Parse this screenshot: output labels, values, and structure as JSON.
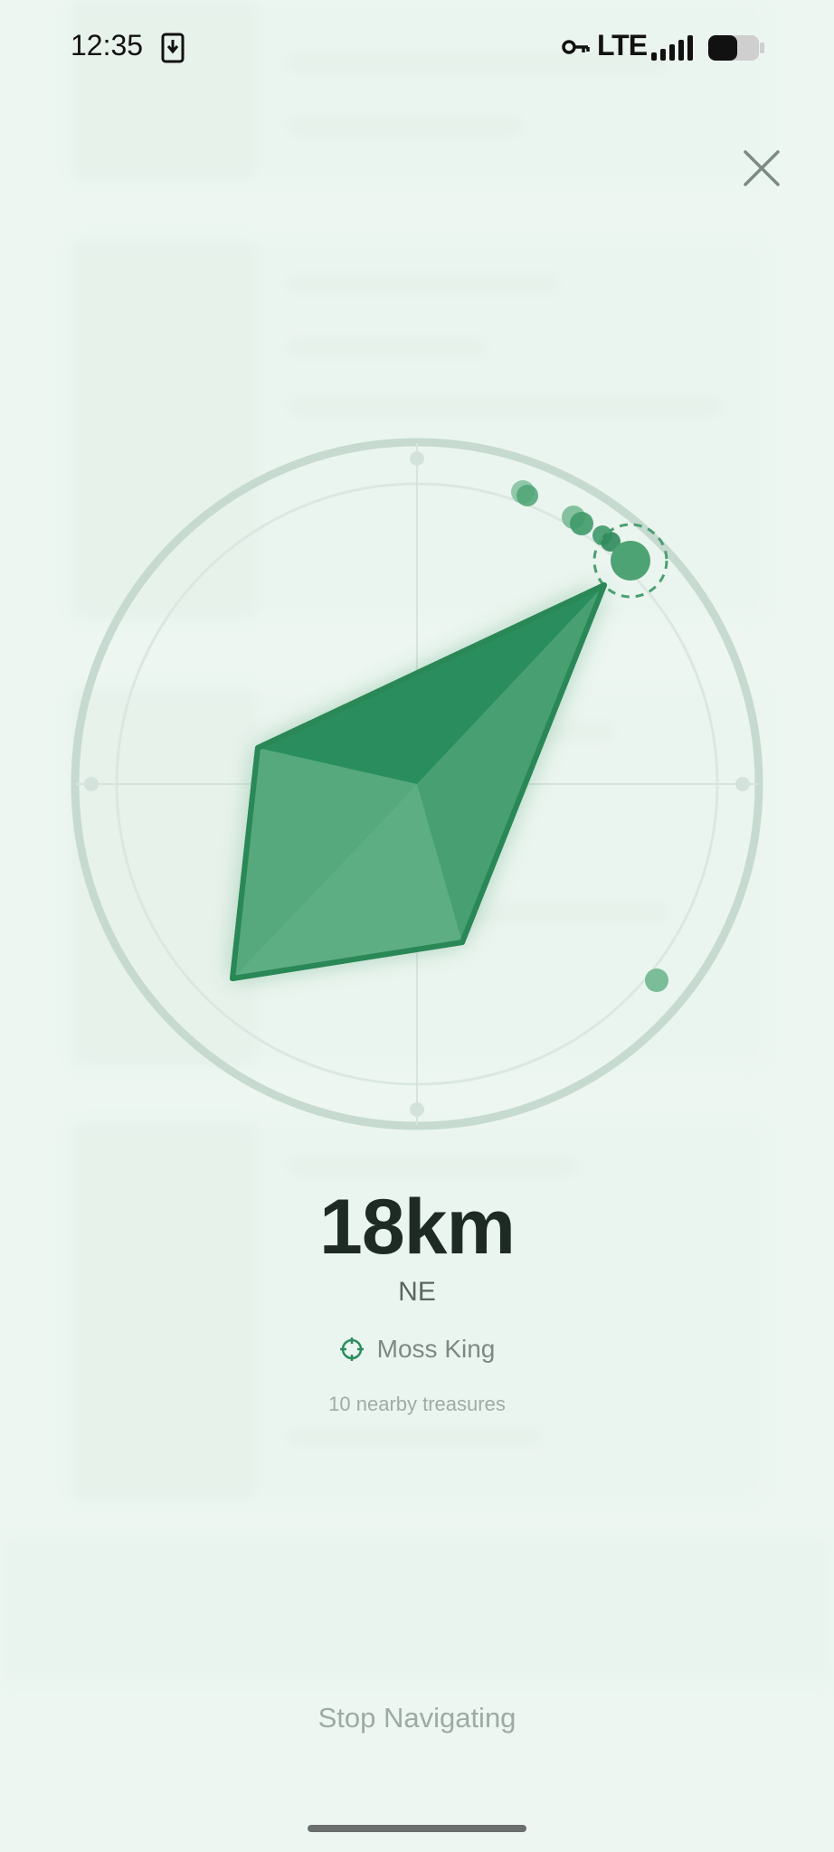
{
  "status_bar": {
    "time": "12:35",
    "network": "LTE",
    "icons": [
      "download-icon",
      "vpn-key-icon",
      "signal-icon",
      "battery-icon"
    ]
  },
  "navigator": {
    "distance": "18km",
    "direction": "NE",
    "target_name": "Moss King",
    "nearby_text": "10 nearby treasures",
    "stop_label": "Stop Navigating"
  },
  "colors": {
    "accent": "#2a8d5e",
    "accent_light": "#5fae86",
    "ring": "#c8dcd2",
    "background": "#edf6f1"
  }
}
